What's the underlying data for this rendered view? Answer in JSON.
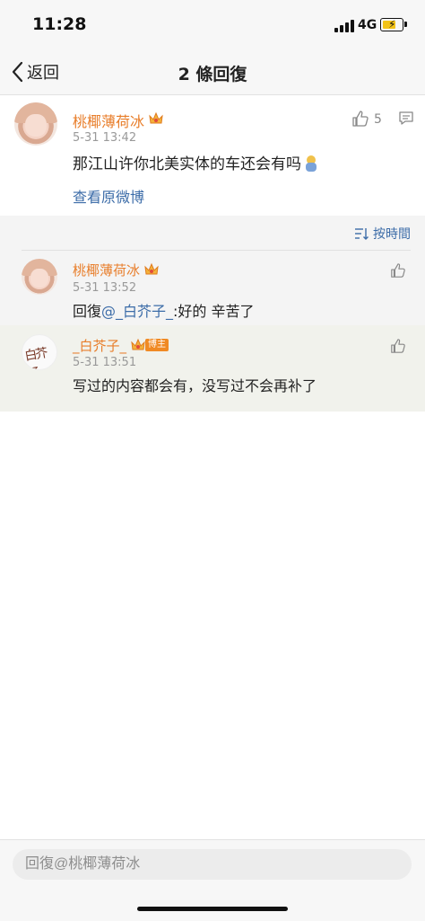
{
  "status_bar": {
    "time": "11:28",
    "network": "4G",
    "battery_color": "#f3c317"
  },
  "nav": {
    "back_label": "返回",
    "title": "2 條回復"
  },
  "main_post": {
    "user_name": "桃椰薄荷冰",
    "timestamp": "5-31 13:42",
    "text": "那江山许你北美实体的车还会有吗",
    "emoji": "baby-emoji",
    "like_count": "5",
    "view_original_label": "查看原微博"
  },
  "sort": {
    "label": "按時間"
  },
  "replies": [
    {
      "user_name": "桃椰薄荷冰",
      "timestamp": "5-31 13:52",
      "prefix": "回復",
      "mention": "@_白芥子_",
      "text": ":好的 辛苦了"
    },
    {
      "user_name": "_白芥子_",
      "badge": "博主",
      "timestamp": "5-31 13:51",
      "text": "写过的内容都会有，没写过不会再补了"
    }
  ],
  "reply_input": {
    "placeholder": "回復@桃椰薄荷冰"
  },
  "colors": {
    "name": "#e87e2b",
    "link": "#3c6ca8",
    "badge": "#f08a24"
  }
}
